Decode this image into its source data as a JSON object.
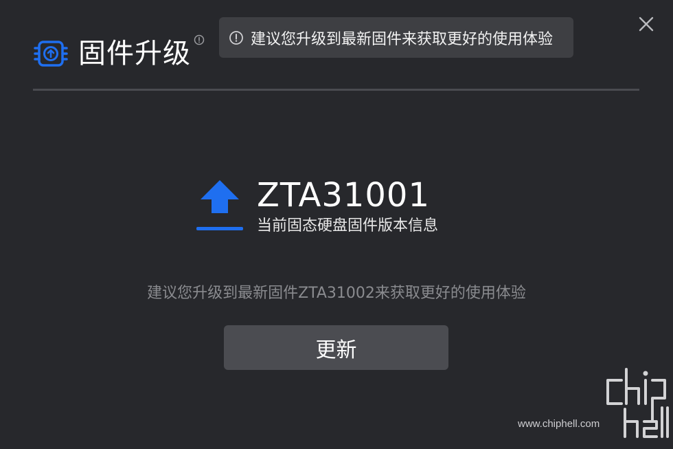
{
  "dialog": {
    "title": "固件升级",
    "close_icon": "close-icon",
    "title_icon": "chip-upload-icon"
  },
  "tooltip": {
    "icon": "info-circle-icon",
    "text": "建议您升级到最新固件来获取更好的使用体验"
  },
  "firmware": {
    "icon": "upload-arrow-icon",
    "current_version": "ZTA31001",
    "caption": "当前固态硬盘固件版本信息"
  },
  "suggestion": "建议您升级到最新固件ZTA31002来获取更好的使用体验",
  "actions": {
    "update_label": "更新"
  },
  "watermark": {
    "url": "www.chiphell.com",
    "logo": "chiphell-logo"
  },
  "colors": {
    "background": "#27282c",
    "accent": "#1f6ff0",
    "button": "#4b4c51",
    "tooltip": "#3e3f43",
    "muted_text": "#8a8b8f"
  }
}
